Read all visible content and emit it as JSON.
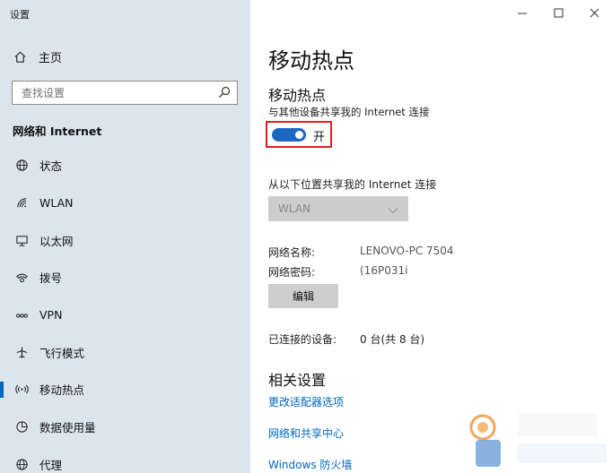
{
  "window": {
    "title": "设置"
  },
  "sidebar": {
    "home_label": "主页",
    "search_placeholder": "查找设置",
    "section_title": "网络和 Internet",
    "items": [
      {
        "label": "状态",
        "icon": "globe-icon"
      },
      {
        "label": "WLAN",
        "icon": "wifi-icon"
      },
      {
        "label": "以太网",
        "icon": "ethernet-icon"
      },
      {
        "label": "拨号",
        "icon": "dialup-icon"
      },
      {
        "label": "VPN",
        "icon": "vpn-icon"
      },
      {
        "label": "飞行模式",
        "icon": "airplane-icon"
      },
      {
        "label": "移动热点",
        "icon": "hotspot-icon",
        "active": true
      },
      {
        "label": "数据使用量",
        "icon": "data-usage-icon"
      },
      {
        "label": "代理",
        "icon": "globe-icon"
      }
    ]
  },
  "content": {
    "page_title": "移动热点",
    "hotspot_heading": "移动热点",
    "share_desc": "与其他设备共享我的 Internet 连接",
    "toggle_state": "开",
    "share_from_label": "从以下位置共享我的 Internet 连接",
    "share_from_value": "WLAN",
    "network_name_label": "网络名称:",
    "network_name_value": "LENOVO-PC 7504",
    "network_password_label": "网络密码:",
    "network_password_value": "(16P031i",
    "edit_label": "编辑",
    "connected_label": "已连接的设备:",
    "connected_value": "0 台(共 8 台)",
    "related_heading": "相关设置",
    "links": [
      "更改适配器选项",
      "网络和共享中心",
      "Windows 防火墙"
    ]
  },
  "colors": {
    "accent": "#0067c0",
    "toggle": "#1a67c4",
    "highlight_border": "#e02020",
    "sidebar_bg": "#dde5ec"
  }
}
